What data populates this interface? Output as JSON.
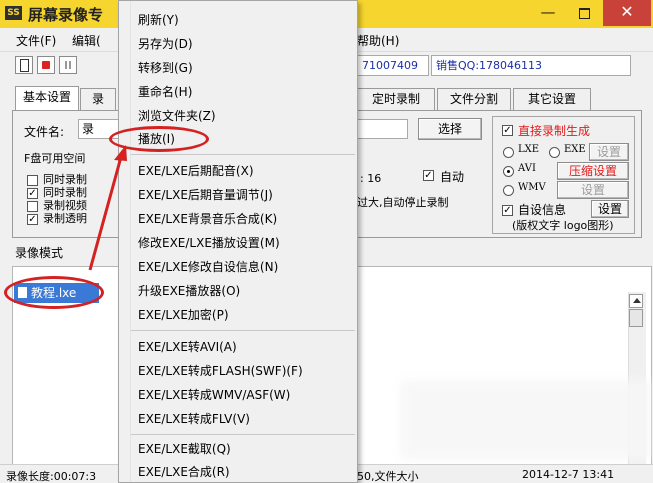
{
  "window": {
    "title": "屏幕录像专"
  },
  "titlebar": {
    "min_glyph": "—",
    "close_glyph": "✕"
  },
  "menubar": {
    "file": "文件(F)",
    "edit": "编辑(",
    "help": "帮助(H)"
  },
  "toolbar": {
    "qq1": "71007409",
    "sales_label": "销售QQ:",
    "sales_qq": "178046113"
  },
  "tabs": {
    "basic": "基本设置",
    "basic_partial": "录",
    "schedule": "定时录制",
    "split": "文件分割",
    "other": "其它设置"
  },
  "settings": {
    "filename_label": "文件名:",
    "filename_value": "录",
    "browse_button": "选择",
    "disk_space": "F盘可用空间",
    "fps_value": ": 16",
    "auto_label": "自动",
    "auto_stop": "过大,自动停止录制",
    "check_labels": [
      "同时录制",
      "同时录制",
      "录制视频",
      "录制透明"
    ],
    "check_states": [
      false,
      true,
      false,
      true
    ]
  },
  "right_group": {
    "direct_record": "直接录制生成",
    "lxe": "LXE",
    "exe": "EXE",
    "settings_button": "设置",
    "avi": "AVI",
    "compress_button": "压缩设置",
    "wmv": "WMV",
    "wmv_settings": "设置",
    "self_info": "自设信息",
    "self_info_button": "设置",
    "copyright": "(版权文字 logo图形)"
  },
  "list": {
    "mode_label": "录像模式",
    "file_item": "教程.lxe"
  },
  "statusbar": {
    "length": "录像长度:00:07:3",
    "file_info": "50,文件大小",
    "date": "2014-12-7 13:41"
  },
  "context_menu": {
    "items": [
      "刷新(Y)",
      "另存为(D)",
      "转移到(G)",
      "重命名(H)",
      "浏览文件夹(Z)",
      "播放(I)",
      "EXE/LXE后期配音(X)",
      "EXE/LXE后期音量调节(J)",
      "EXE/LXE背景音乐合成(K)",
      "修改EXE/LXE播放设置(M)",
      "EXE/LXE修改自设信息(N)",
      "升级EXE播放器(O)",
      "EXE/LXE加密(P)",
      "EXE/LXE转AVI(A)",
      "EXE/LXE转成FLASH(SWF)(F)",
      "EXE/LXE转成WMV/ASF(W)",
      "EXE/LXE转成FLV(V)",
      "EXE/LXE截取(Q)",
      "EXE/LXE合成(R)"
    ]
  },
  "colors": {
    "titlebar": "#f6d52f",
    "close": "#c94239",
    "annotation": "#d42121",
    "selection": "#3a79d6",
    "red_text": "#e11b1b"
  }
}
